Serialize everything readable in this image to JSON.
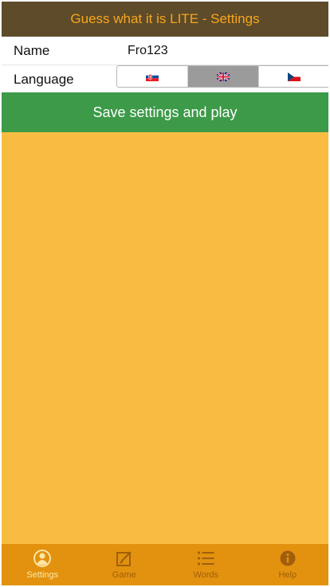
{
  "header": {
    "title": "Guess what it is LITE - Settings"
  },
  "form": {
    "name_label": "Name",
    "name_value": "Fro123",
    "language_label": "Language",
    "languages": [
      {
        "code": "sk",
        "icon": "slovak-flag-icon",
        "active": false
      },
      {
        "code": "en",
        "icon": "uk-flag-icon",
        "active": true
      },
      {
        "code": "cz",
        "icon": "czech-flag-icon",
        "active": false
      }
    ]
  },
  "save_button": {
    "label": "Save settings and play"
  },
  "navbar": {
    "items": [
      {
        "label": "Settings",
        "icon": "user-circle-icon",
        "active": true
      },
      {
        "label": "Game",
        "icon": "edit-icon",
        "active": false
      },
      {
        "label": "Words",
        "icon": "list-icon",
        "active": false
      },
      {
        "label": "Help",
        "icon": "info-icon",
        "active": false
      }
    ]
  },
  "colors": {
    "header_bg": "#5d4b2a",
    "header_text": "#f9a61a",
    "content_bg": "#f9bc43",
    "save_button_bg": "#3c9a48",
    "navbar_bg": "#e2920e",
    "nav_active": "#fde6a6",
    "nav_inactive": "#a15e0a"
  }
}
